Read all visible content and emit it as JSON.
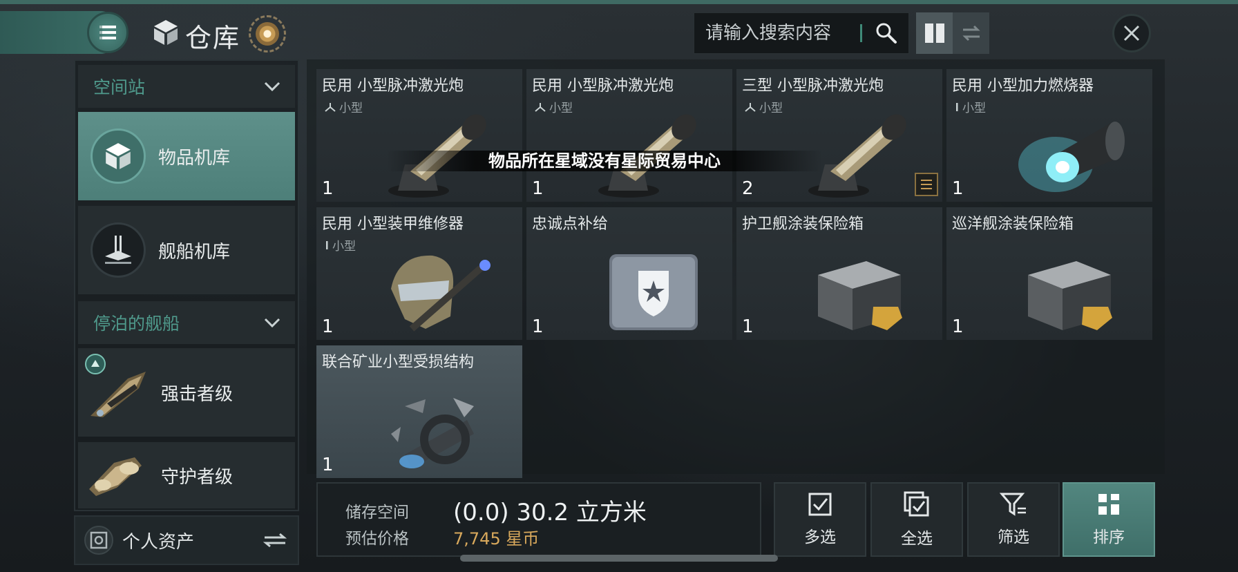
{
  "header": {
    "title": "仓库",
    "menu_icon": "hamburger-icon",
    "search_placeholder": "请输入搜索内容",
    "accent": "#3f6a63"
  },
  "sidebar": {
    "sections": [
      {
        "label": "空间站"
      },
      {
        "label": "停泊的舰船"
      }
    ],
    "items": [
      {
        "label": "物品机库",
        "icon": "cube-icon",
        "active": true
      },
      {
        "label": "舰船机库",
        "icon": "ship-hangar-icon",
        "active": false
      },
      {
        "label": "强击者级",
        "icon": "ship-image",
        "active": false
      },
      {
        "label": "守护者级",
        "icon": "ship-image",
        "active": false
      }
    ],
    "assets_label": "个人资产"
  },
  "items": [
    {
      "name": "民用 小型脉冲激光炮",
      "size": "小型",
      "qty": "1",
      "art": "laser"
    },
    {
      "name": "民用 小型脉冲激光炮",
      "size": "小型",
      "qty": "1",
      "art": "laser"
    },
    {
      "name": "三型 小型脉冲激光炮",
      "size": "小型",
      "qty": "2",
      "art": "laser"
    },
    {
      "name": "民用 小型加力燃烧器",
      "size": "小型",
      "qty": "1",
      "art": "afterburner"
    },
    {
      "name": "民用 小型装甲维修器",
      "size": "小型",
      "qty": "1",
      "art": "repairer"
    },
    {
      "name": "忠诚点补给",
      "size": "",
      "qty": "1",
      "art": "loyalty"
    },
    {
      "name": "护卫舰涂装保险箱",
      "size": "",
      "qty": "1",
      "art": "crate"
    },
    {
      "name": "巡洋舰涂装保险箱",
      "size": "",
      "qty": "1",
      "art": "crate"
    },
    {
      "name": "联合矿业小型受损结构",
      "size": "",
      "qty": "1",
      "art": "salvage"
    }
  ],
  "toast": "物品所在星域没有星际贸易中心",
  "storage": {
    "space_label": "储存空间",
    "space_value": "(0.0) 30.2 立方米",
    "price_label": "预估价格",
    "price_value": "7,745 星币",
    "price_color": "#d9a95c"
  },
  "actions": [
    {
      "label": "多选",
      "icon": "checkbox-icon"
    },
    {
      "label": "全选",
      "icon": "select-all-icon"
    },
    {
      "label": "筛选",
      "icon": "filter-icon"
    },
    {
      "label": "排序",
      "icon": "grid-sort-icon"
    }
  ]
}
